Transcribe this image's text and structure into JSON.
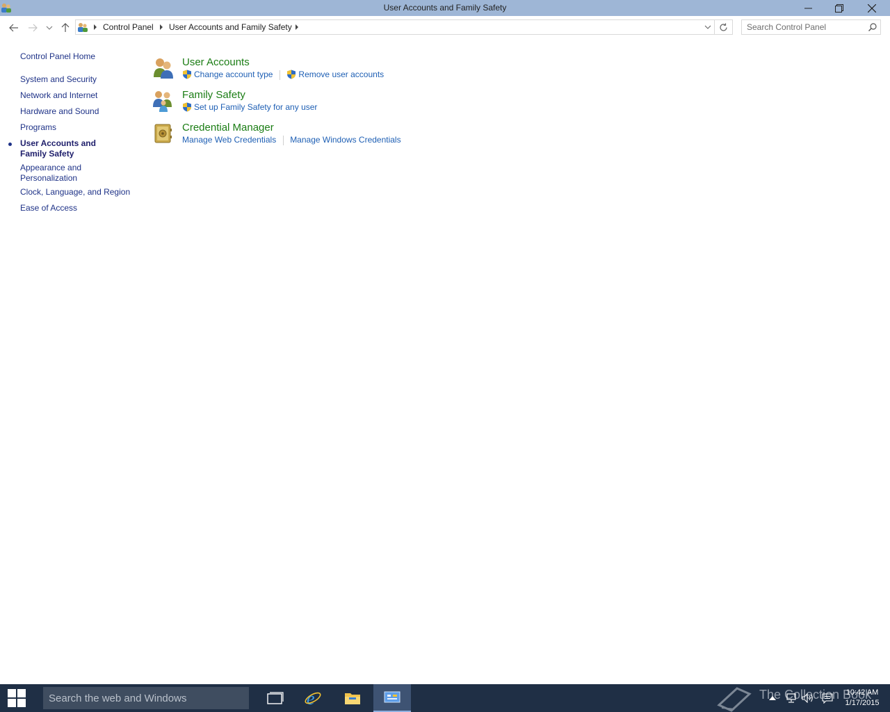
{
  "window": {
    "title": "User Accounts and Family Safety",
    "icon": "control-panel-users-icon"
  },
  "nav": {
    "breadcrumbs": [
      "Control Panel",
      "User Accounts and Family Safety"
    ],
    "search_placeholder": "Search Control Panel"
  },
  "left_pane": {
    "home": "Control Panel Home",
    "items": [
      {
        "label": "System and Security",
        "current": false
      },
      {
        "label": "Network and Internet",
        "current": false
      },
      {
        "label": "Hardware and Sound",
        "current": false
      },
      {
        "label": "Programs",
        "current": false
      },
      {
        "label": "User Accounts and Family Safety",
        "current": true
      },
      {
        "label": "Appearance and Personalization",
        "current": false
      },
      {
        "label": "Clock, Language, and Region",
        "current": false
      },
      {
        "label": "Ease of Access",
        "current": false
      }
    ]
  },
  "categories": [
    {
      "title": "User Accounts",
      "icon": "user-accounts-icon",
      "tasks": [
        {
          "label": "Change account type",
          "shield": true
        },
        {
          "label": "Remove user accounts",
          "shield": true
        }
      ]
    },
    {
      "title": "Family Safety",
      "icon": "family-safety-icon",
      "tasks": [
        {
          "label": "Set up Family Safety for any user",
          "shield": true
        }
      ]
    },
    {
      "title": "Credential Manager",
      "icon": "credential-manager-icon",
      "tasks": [
        {
          "label": "Manage Web Credentials",
          "shield": false
        },
        {
          "label": "Manage Windows Credentials",
          "shield": false
        }
      ]
    }
  ],
  "taskbar": {
    "search_placeholder": "Search the web and Windows",
    "watermark": "The Collection Book",
    "time": "10:42 AM",
    "date": "1/17/2015"
  },
  "colors": {
    "titlebar": "#9eb6d6",
    "category_title": "#1b7d14",
    "task_link": "#1e5fb4",
    "nav_link": "#1e3287",
    "taskbar": "#1f2f45"
  }
}
